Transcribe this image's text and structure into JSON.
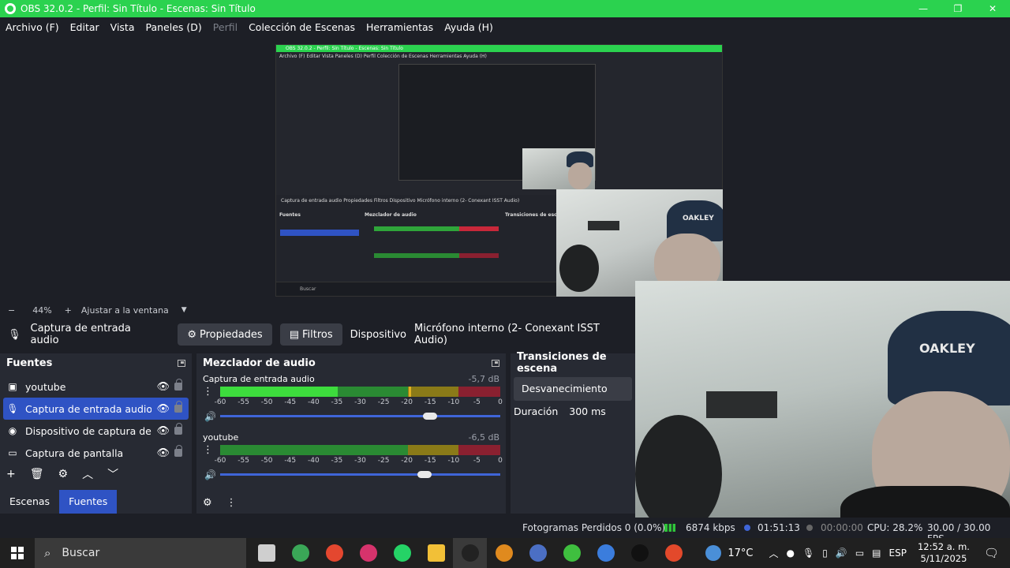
{
  "window": {
    "title": "OBS 32.0.2 - Perfil: Sin Título - Escenas: Sin Título",
    "minimize": "—",
    "maximize": "❐",
    "close": "✕"
  },
  "menu": [
    "Archivo (F)",
    "Editar",
    "Vista",
    "Paneles (D)",
    "Perfil",
    "Colección de Escenas",
    "Herramientas",
    "Ayuda (H)"
  ],
  "zoom": {
    "minus": "−",
    "level": "44%",
    "plus": "+",
    "fit_label": "Ajustar a la ventana",
    "dropdown": "▼"
  },
  "context": {
    "source_name": "Captura de entrada audio",
    "properties": "Propiedades",
    "filters": "Filtros",
    "device_label": "Dispositivo",
    "device_value": "Micrófono interno (2- Conexant ISST Audio)"
  },
  "sources": {
    "title": "Fuentes",
    "items": [
      {
        "label": "youtube",
        "icon": "window-icon"
      },
      {
        "label": "Captura de entrada audio",
        "icon": "mic-icon",
        "selected": true
      },
      {
        "label": "Dispositivo de captura de vídeo",
        "icon": "camera-icon"
      },
      {
        "label": "Captura de pantalla",
        "icon": "monitor-icon"
      }
    ],
    "toolbar": {
      "add": "+",
      "remove": "🗑",
      "settings": "⚙",
      "up": "︿",
      "down": "﹀"
    }
  },
  "tabs": {
    "scenes": "Escenas",
    "sources": "Fuentes"
  },
  "mixer": {
    "title": "Mezclador de audio",
    "ticks": [
      "-60",
      "-55",
      "-50",
      "-45",
      "-40",
      "-35",
      "-30",
      "-25",
      "-20",
      "-15",
      "-10",
      "-5",
      "0"
    ],
    "channels": [
      {
        "name": "Captura de entrada audio",
        "db": "-5,7 dB",
        "level": 0.42,
        "peak": 0.77,
        "volume": 0.75
      },
      {
        "name": "youtube",
        "db": "-6,5 dB",
        "level": 0.0,
        "peak": 0.0,
        "volume": 0.73
      }
    ]
  },
  "transitions": {
    "title": "Transiciones de escena",
    "selected": "Desvanecimiento",
    "duration_label": "Duración",
    "duration_value": "300 ms"
  },
  "status": {
    "dropped": "Fotogramas Perdidos 0 (0.0%)",
    "bitrate": "6874 kbps",
    "rec_time": "01:51:13",
    "stream_time": "00:00:00",
    "cpu": "CPU: 28.2%",
    "fps": "30.00 / 30.00 FPS"
  },
  "taskbar": {
    "search_placeholder": "Buscar",
    "weather": "17°C",
    "lang": "ESP",
    "time": "12:52 a. m.",
    "date": "5/11/2025",
    "apps": [
      {
        "name": "task-view-icon",
        "color": "#cfcfcf"
      },
      {
        "name": "chrome-icon",
        "color": "#3aa757"
      },
      {
        "name": "chrome-alt-icon",
        "color": "#e4472f"
      },
      {
        "name": "instagram-icon",
        "color": "#d6336c"
      },
      {
        "name": "whatsapp-icon",
        "color": "#25d366"
      },
      {
        "name": "file-explorer-icon",
        "color": "#f2c037"
      },
      {
        "name": "obs-icon",
        "color": "#222222"
      },
      {
        "name": "app-orange-icon",
        "color": "#e08a1e"
      },
      {
        "name": "app-blue-icon",
        "color": "#4b6fc4"
      },
      {
        "name": "app-green-icon",
        "color": "#3fbf3f"
      },
      {
        "name": "app-cap-icon",
        "color": "#3b7ddd"
      },
      {
        "name": "tiktok-icon",
        "color": "#111111"
      },
      {
        "name": "brave-icon",
        "color": "#e3492b"
      }
    ]
  },
  "nested_preview": {
    "title": "OBS 32.0.2 - Perfil: Sin Título - Escenas: Sin Título",
    "menu": "Archivo (F)   Editar   Vista   Paneles (D)   Perfil   Colección de Escenas   Herramientas   Ayuda (H)",
    "context": "Captura de entrada audio    Propiedades    Filtros    Dispositivo    Micrófono interno (2- Conexant ISST Audio)",
    "sources_title": "Fuentes",
    "mixer_title": "Mezclador de audio",
    "trans_title": "Transiciones de escena",
    "taskbar_search": "Buscar"
  },
  "cap_logo": "OAKLEY",
  "colors": {
    "accent": "#2f53c4",
    "titlebar": "#2bd24f",
    "meter_green": "#3ddc3d",
    "meter_yellow": "#b5a31e",
    "meter_red": "#c8283a"
  }
}
